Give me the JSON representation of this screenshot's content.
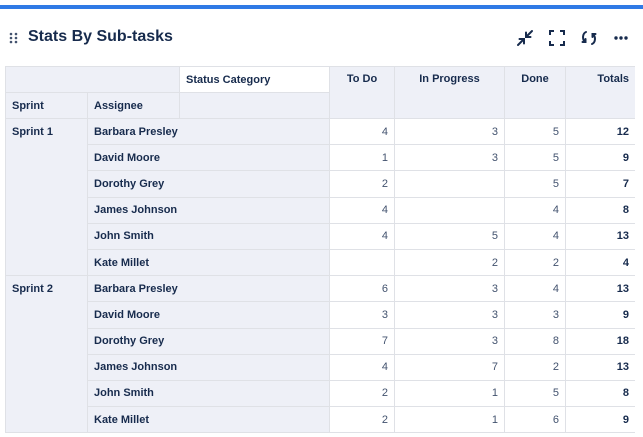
{
  "widget": {
    "title": "Stats By Sub-tasks",
    "accent": "#2f7ae5",
    "icons": [
      "drag-handle-icon",
      "collapse-icon",
      "fullscreen-icon",
      "refresh-icon",
      "more-icon"
    ]
  },
  "table": {
    "header": {
      "status_category": "Status Category",
      "sprint": "Sprint",
      "assignee": "Assignee",
      "todo": "To Do",
      "in_progress": "In Progress",
      "done": "Done",
      "totals": "Totals"
    },
    "groups": [
      {
        "sprint": "Sprint 1",
        "rows": [
          {
            "assignee": "Barbara Presley",
            "todo": "4",
            "in_progress": "3",
            "done": "5",
            "total": "12"
          },
          {
            "assignee": "David Moore",
            "todo": "1",
            "in_progress": "3",
            "done": "5",
            "total": "9"
          },
          {
            "assignee": "Dorothy Grey",
            "todo": "2",
            "in_progress": "",
            "done": "5",
            "total": "7"
          },
          {
            "assignee": "James Johnson",
            "todo": "4",
            "in_progress": "",
            "done": "4",
            "total": "8"
          },
          {
            "assignee": "John Smith",
            "todo": "4",
            "in_progress": "5",
            "done": "4",
            "total": "13"
          },
          {
            "assignee": "Kate Millet",
            "todo": "",
            "in_progress": "2",
            "done": "2",
            "total": "4"
          }
        ]
      },
      {
        "sprint": "Sprint 2",
        "rows": [
          {
            "assignee": "Barbara Presley",
            "todo": "6",
            "in_progress": "3",
            "done": "4",
            "total": "13"
          },
          {
            "assignee": "David Moore",
            "todo": "3",
            "in_progress": "3",
            "done": "3",
            "total": "9"
          },
          {
            "assignee": "Dorothy Grey",
            "todo": "7",
            "in_progress": "3",
            "done": "8",
            "total": "18"
          },
          {
            "assignee": "James Johnson",
            "todo": "4",
            "in_progress": "7",
            "done": "2",
            "total": "13"
          },
          {
            "assignee": "John Smith",
            "todo": "2",
            "in_progress": "1",
            "done": "5",
            "total": "8"
          },
          {
            "assignee": "Kate Millet",
            "todo": "2",
            "in_progress": "1",
            "done": "6",
            "total": "9"
          }
        ]
      }
    ]
  }
}
